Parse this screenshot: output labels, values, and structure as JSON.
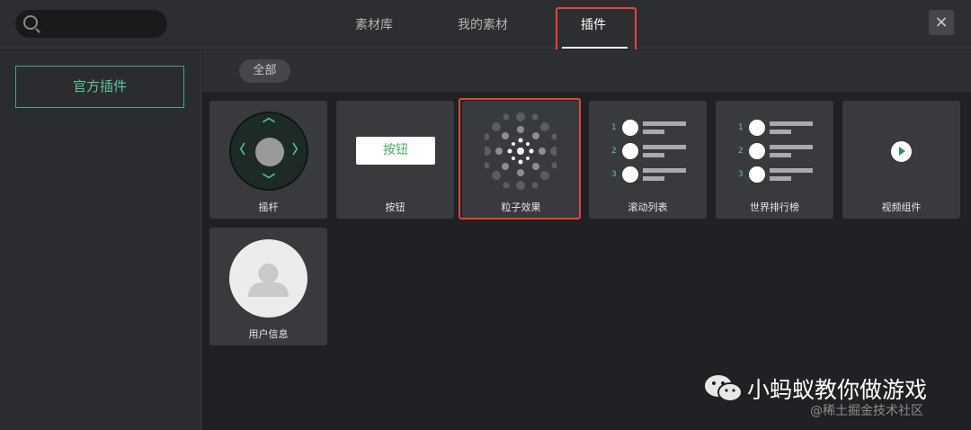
{
  "search": {
    "placeholder": ""
  },
  "tabs": [
    "素材库",
    "我的素材",
    "插件"
  ],
  "close": "×",
  "sidebar": {
    "items": [
      {
        "label": "官方插件"
      }
    ]
  },
  "filter": {
    "label": "全部"
  },
  "plugins": [
    {
      "label": "摇杆",
      "icon": "joystick-icon"
    },
    {
      "label": "按钮",
      "icon": "button-icon",
      "preview_text": "按钮"
    },
    {
      "label": "粒子效果",
      "icon": "particle-icon"
    },
    {
      "label": "滚动列表",
      "icon": "scroll-list-icon"
    },
    {
      "label": "世界排行榜",
      "icon": "leaderboard-icon"
    },
    {
      "label": "视频组件",
      "icon": "play-icon"
    },
    {
      "label": "用户信息",
      "icon": "user-avatar-icon"
    }
  ],
  "list_numbers": [
    "1",
    "2",
    "3"
  ],
  "watermark": {
    "title": "小蚂蚁教你做游戏",
    "subtitle": "@稀土掘金技术社区"
  },
  "colors": {
    "accent": "#5ec69a",
    "highlight": "#e0463d",
    "background": "#202124"
  }
}
